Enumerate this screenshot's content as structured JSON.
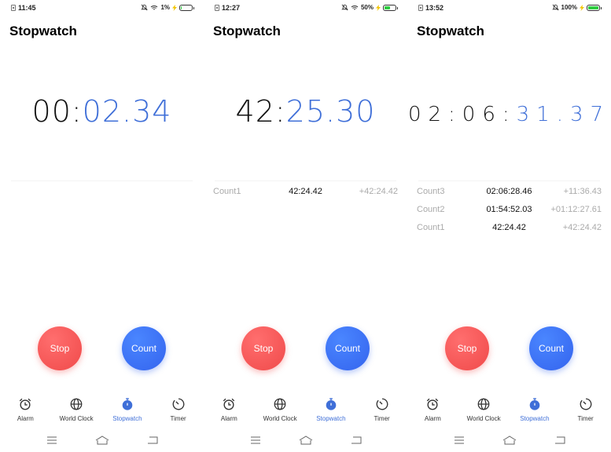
{
  "screens": [
    {
      "status": {
        "time": "11:45",
        "battery_text": "1%",
        "battery_level": 0.01,
        "wifi": true
      },
      "title": "Stopwatch",
      "timer": {
        "hm": "00:",
        "sec": "02.34"
      },
      "laps": [],
      "buttons": {
        "stop": "Stop",
        "count": "Count"
      }
    },
    {
      "status": {
        "time": "12:27",
        "battery_text": "50%",
        "battery_level": 0.5,
        "wifi": true
      },
      "title": "Stopwatch",
      "timer": {
        "hm": "42:",
        "sec": "25.30"
      },
      "laps": [
        {
          "name": "Count1",
          "total": "42:24.42",
          "diff": "+42:24.42"
        }
      ],
      "buttons": {
        "stop": "Stop",
        "count": "Count"
      }
    },
    {
      "status": {
        "time": "13:52",
        "battery_text": "100%",
        "battery_level": 1.0,
        "wifi": false
      },
      "title": "Stopwatch",
      "timer": {
        "hm": "02:06:",
        "sec": "31.37"
      },
      "laps": [
        {
          "name": "Count3",
          "total": "02:06:28.46",
          "diff": "+11:36.43"
        },
        {
          "name": "Count2",
          "total": "01:54:52.03",
          "diff": "+01:12:27.61"
        },
        {
          "name": "Count1",
          "total": "42:24.42",
          "diff": "+42:24.42"
        }
      ],
      "buttons": {
        "stop": "Stop",
        "count": "Count"
      }
    }
  ],
  "tabs": [
    {
      "label": "Alarm",
      "icon": "alarm-icon"
    },
    {
      "label": "World Clock",
      "icon": "globe-icon"
    },
    {
      "label": "Stopwatch",
      "icon": "stopwatch-icon",
      "active": true
    },
    {
      "label": "Timer",
      "icon": "timer-icon"
    }
  ],
  "colors": {
    "accent": "#3f6fd8",
    "stop": "#f04a4a",
    "count": "#3464ee",
    "muted": "#aaaaaa"
  }
}
